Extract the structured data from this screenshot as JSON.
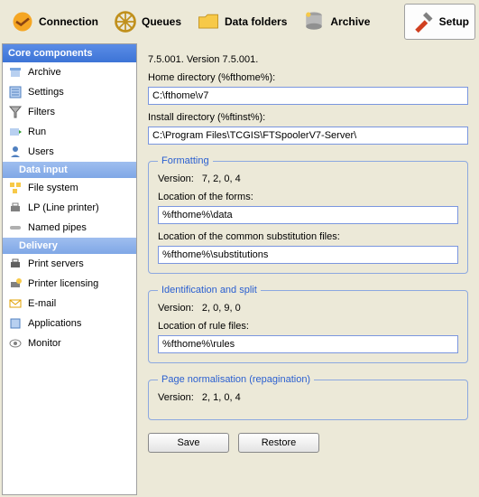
{
  "toolbar": {
    "connection": "Connection",
    "queues": "Queues",
    "datafolders": "Data folders",
    "archive": "Archive",
    "setup": "Setup"
  },
  "sidebar": {
    "core": "Core components",
    "items1": [
      "Archive",
      "Settings",
      "Filters",
      "Run",
      "Users"
    ],
    "datainput": "Data input",
    "items2": [
      "File system",
      "LP (Line printer)",
      "Named pipes"
    ],
    "delivery": "Delivery",
    "items3": [
      "Print servers",
      "Printer licensing",
      "E-mail",
      "Applications",
      "Monitor"
    ]
  },
  "main": {
    "versionLine": "7.5.001. Version 7.5.001.",
    "homeLabel": "Home directory (%fthome%):",
    "homeVal": "C:\\fthome\\v7",
    "instLabel": "Install directory (%ftinst%):",
    "instVal": "C:\\Program Files\\TCGIS\\FTSpoolerV7-Server\\",
    "formatting": {
      "legend": "Formatting",
      "versionLabel": "Version:",
      "version": "7, 2, 0, 4",
      "formsLabel": "Location of the forms:",
      "formsVal": "%fthome%\\data",
      "subsLabel": "Location of the common substitution files:",
      "subsVal": "%fthome%\\substitutions"
    },
    "ident": {
      "legend": "Identification and split",
      "versionLabel": "Version:",
      "version": "2, 0, 9, 0",
      "rulesLabel": "Location of rule files:",
      "rulesVal": "%fthome%\\rules"
    },
    "repag": {
      "legend": "Page normalisation (repagination)",
      "versionLabel": "Version:",
      "version": "2, 1, 0, 4"
    },
    "save": "Save",
    "restore": "Restore"
  }
}
